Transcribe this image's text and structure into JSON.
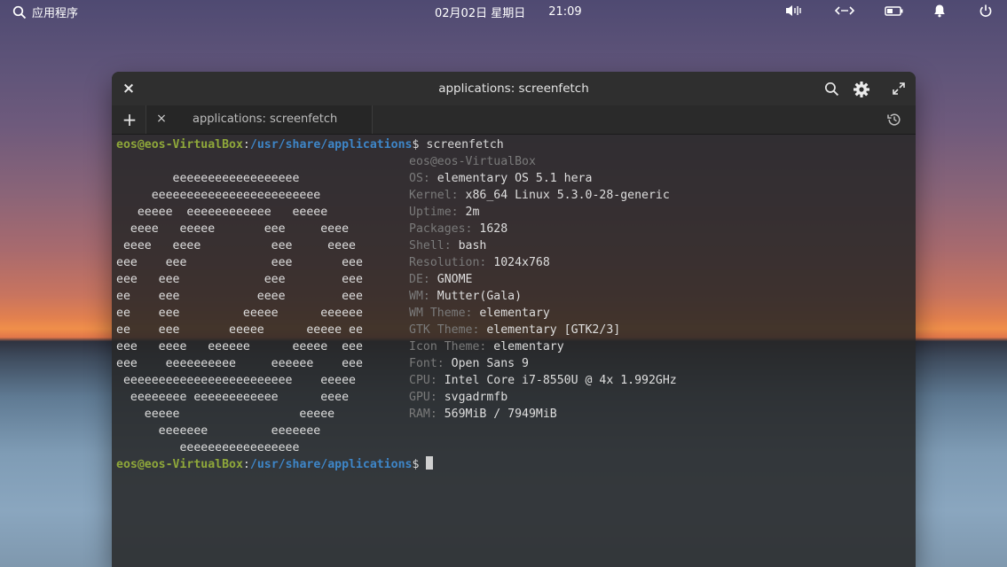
{
  "topbar": {
    "apps_label": "应用程序",
    "date": "02月02日 星期日",
    "time": "21:09"
  },
  "window": {
    "title": "applications: screenfetch",
    "tab_label": "applications: screenfetch",
    "new_tab_label": "+",
    "close_glyph": "×"
  },
  "terminal": {
    "prompt_user": "eos@eos-VirtualBox",
    "prompt_sep": ":",
    "prompt_path": "/usr/share/applications",
    "prompt_symbol": "$",
    "command": " screenfetch",
    "logo": [
      "",
      "                                  ",
      "        eeeeeeeeeeeeeeeeee        ",
      "     eeeeeeeeeeeeeeeeeeeeeeee     ",
      "   eeeee  eeeeeeeeeeee   eeeee   ",
      "  eeee   eeeee       eee     eeee  ",
      " eeee   eeee          eee     eeee ",
      "eee    eee            eee       eee",
      "eee   eee            eee        eee",
      "ee    eee           eeee        eee",
      "ee    eee         eeeee      eeeeee",
      "ee    eee       eeeee      eeeee ee",
      "eee   eeee   eeeeee      eeeee  eee",
      "eee    eeeeeeeeee     eeeeee    eee",
      " eeeeeeeeeeeeeeeeeeeeeeee    eeeee ",
      "  eeeeeeee eeeeeeeeeeee      eeee  ",
      "    eeeee                 eeeee    ",
      "      eeeeeee         eeeeeee      ",
      "         eeeeeeeeeeeeeeeee         "
    ],
    "info": [
      {
        "label": "eos@eos-VirtualBox",
        "value": ""
      },
      {
        "label": "OS: ",
        "value": "elementary OS 5.1 hera"
      },
      {
        "label": "Kernel: ",
        "value": "x86_64 Linux 5.3.0-28-generic"
      },
      {
        "label": "Uptime: ",
        "value": "2m"
      },
      {
        "label": "Packages: ",
        "value": "1628"
      },
      {
        "label": "Shell: ",
        "value": "bash"
      },
      {
        "label": "Resolution: ",
        "value": "1024x768"
      },
      {
        "label": "DE: ",
        "value": "GNOME"
      },
      {
        "label": "WM: ",
        "value": "Mutter(Gala)"
      },
      {
        "label": "WM Theme: ",
        "value": "elementary"
      },
      {
        "label": "GTK Theme: ",
        "value": "elementary [GTK2/3]"
      },
      {
        "label": "Icon Theme: ",
        "value": "elementary"
      },
      {
        "label": "Font: ",
        "value": "Open Sans 9"
      },
      {
        "label": "CPU: ",
        "value": "Intel Core i7-8550U @ 4x 1.992GHz"
      },
      {
        "label": "GPU: ",
        "value": "svgadrmfb"
      },
      {
        "label": "RAM: ",
        "value": "569MiB / 7949MiB"
      }
    ]
  },
  "colors": {
    "prompt_user": "#8fa83a",
    "prompt_path": "#3e86c8",
    "info_label": "#7a7a7a"
  },
  "icons": {
    "search": "search-icon",
    "volume": "volume-icon",
    "network": "network-icon",
    "battery": "battery-icon",
    "notification": "bell-icon",
    "power": "power-icon",
    "settings": "gear-icon",
    "fullscreen": "expand-icon",
    "history": "history-icon"
  }
}
